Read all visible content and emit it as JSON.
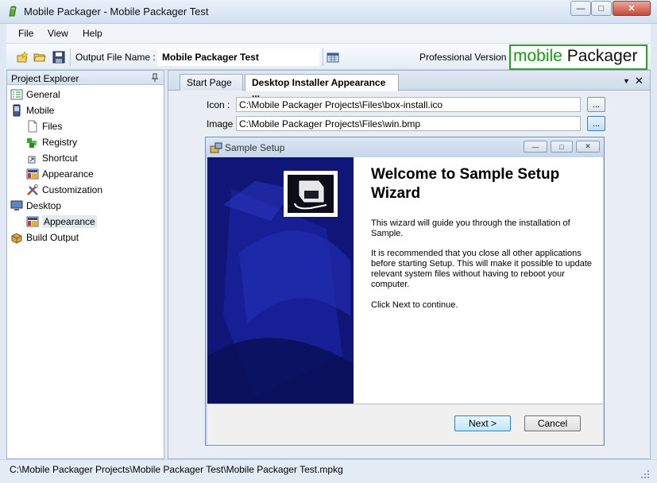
{
  "window": {
    "title": "Mobile Packager - Mobile Packager Test",
    "controls": {
      "minimize": "—",
      "maximize": "□",
      "close": "✕"
    }
  },
  "menu": {
    "items": [
      "File",
      "View",
      "Help"
    ]
  },
  "toolbar": {
    "output_label": "Output File Name :",
    "output_value": "Mobile Packager Test",
    "version": "Professional Version",
    "logo_part1": "mobile",
    "logo_part2": "Packager",
    "icons": [
      "new-project-icon",
      "open-folder-icon",
      "save-icon",
      "calendar-icon"
    ]
  },
  "explorer": {
    "title": "Project Explorer",
    "items": [
      {
        "label": "General",
        "icon": "general-icon"
      },
      {
        "label": "Mobile",
        "icon": "mobile-device-icon"
      },
      {
        "label": "Files",
        "icon": "files-icon"
      },
      {
        "label": "Registry",
        "icon": "registry-icon"
      },
      {
        "label": "Shortcut",
        "icon": "shortcut-icon"
      },
      {
        "label": "Appearance",
        "icon": "appearance-icon"
      },
      {
        "label": "Customization",
        "icon": "customization-icon"
      },
      {
        "label": "Desktop",
        "icon": "desktop-icon"
      },
      {
        "label": "Appearance",
        "icon": "appearance-icon",
        "selected": true
      },
      {
        "label": "Build Output",
        "icon": "build-output-icon"
      }
    ]
  },
  "tabs": [
    {
      "label": "Start Page",
      "active": false
    },
    {
      "label": "Desktop Installer Appearance ...",
      "active": true
    }
  ],
  "tab_controls": {
    "dropdown": "▼",
    "close": "✕"
  },
  "form": {
    "icon_label": "Icon :",
    "icon_value": "C:\\Mobile Packager Projects\\Files\\box-install.ico",
    "image_label": "Image :",
    "image_value": "C:\\Mobile Packager Projects\\Files\\win.bmp",
    "browse_label": "..."
  },
  "preview": {
    "title": "Sample Setup",
    "controls": {
      "minimize": "—",
      "maximize": "□",
      "close": "✕"
    },
    "heading": "Welcome to Sample Setup Wizard",
    "paragraph1": "This wizard will guide you through the installation of Sample.",
    "paragraph2": "It is recommended that you close all other applications before starting Setup. This will make it possible to update relevant system files without having to reboot your computer.",
    "paragraph3": "Click Next to continue.",
    "next_label": "Next >",
    "cancel_label": "Cancel"
  },
  "status": {
    "path": "C:\\Mobile Packager Projects\\Mobile Packager Test\\Mobile Packager Test.mpkg"
  }
}
